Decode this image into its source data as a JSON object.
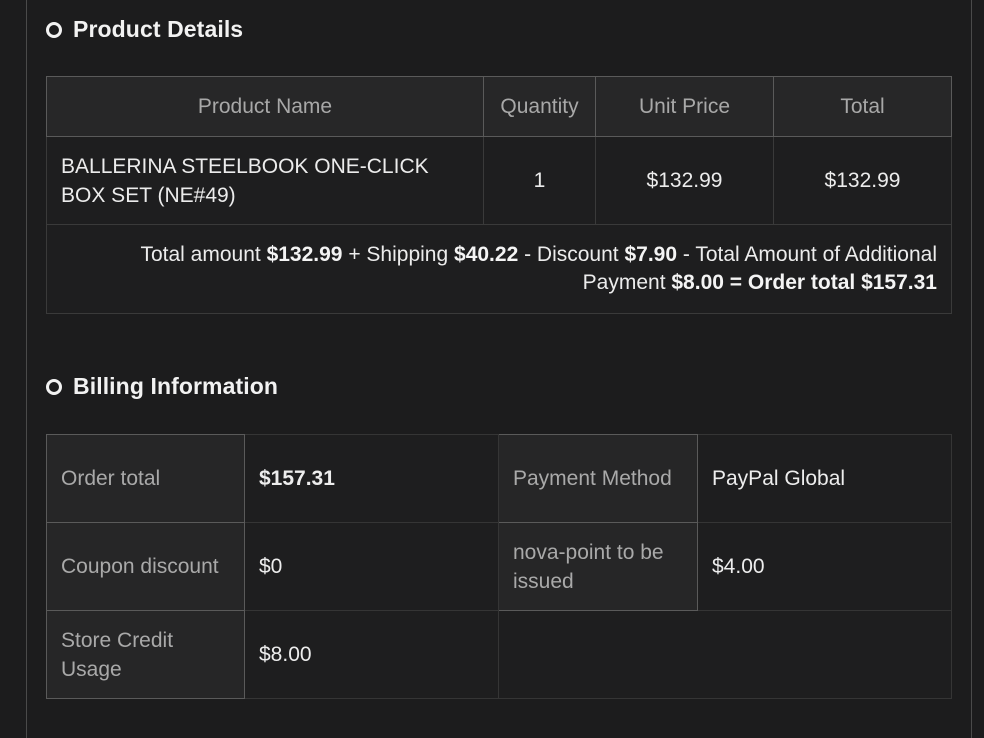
{
  "product_section": {
    "title": "Product Details",
    "columns": [
      "Product Name",
      "Quantity",
      "Unit Price",
      "Total"
    ],
    "rows": [
      {
        "name": "BALLERINA STEELBOOK ONE-CLICK BOX SET (NE#49)",
        "quantity": "1",
        "unit_price": "$132.99",
        "total": "$132.99"
      }
    ],
    "summary": {
      "total_amount_label": "Total amount",
      "total_amount": "$132.99",
      "shipping_label": "+ Shipping",
      "shipping": "$40.22",
      "discount_label": "- Discount",
      "discount": "$7.90",
      "additional_label": "- Total Amount of Additional Payment",
      "additional": "$8.00",
      "order_total_label": "= Order total",
      "order_total": "$157.31"
    }
  },
  "billing_section": {
    "title": "Billing Information",
    "order_total_label": "Order total",
    "order_total": "$157.31",
    "payment_method_label": "Payment Method",
    "payment_method": "PayPal Global",
    "coupon_discount_label": "Coupon discount",
    "coupon_discount": "$0",
    "nova_point_label": "nova-point to be issued",
    "nova_point": "$4.00",
    "store_credit_label": "Store Credit Usage",
    "store_credit": "$8.00"
  }
}
